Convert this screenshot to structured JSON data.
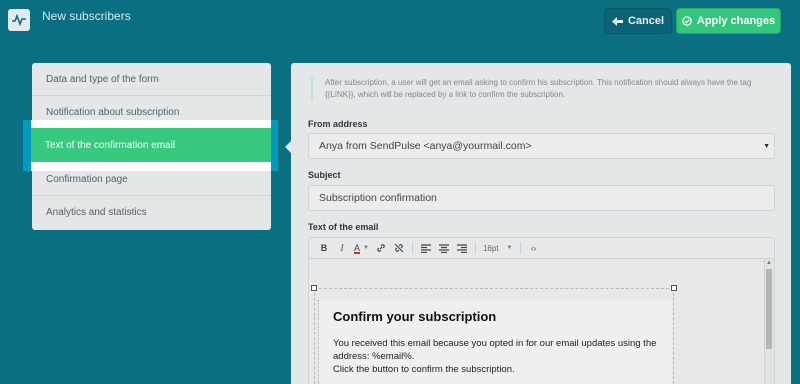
{
  "app": {
    "title": "New subscribers",
    "logo_icon": "pulse-icon"
  },
  "actions": {
    "cancel_label": "Cancel",
    "apply_label": "Apply changes"
  },
  "sidebar": {
    "items": [
      {
        "label": "Data and type of the form"
      },
      {
        "label": "Notification about subscription"
      },
      {
        "label": "Text of the confirmation email"
      },
      {
        "label": "Confirmation page"
      },
      {
        "label": "Analytics and statistics"
      }
    ],
    "active_index": 2
  },
  "panel": {
    "notice": "After subscription, a user will get an email asking to confirm his subscription. This notification should always have the tag {{LINK}}, which will be replaced by a link to confirm the subscription.",
    "from_label": "From address",
    "from_value": "Anya from SendPulse <anya@yourmail.com>",
    "subject_label": "Subject",
    "subject_value": "Subscription confirmation",
    "text_label": "Text of the email",
    "toolbar": {
      "bold": "B",
      "italic": "I",
      "font_color": "A",
      "font_size": "16pt"
    },
    "email": {
      "heading": "Confirm your subscription",
      "body_line1": "You received this email because you opted in for our email updates using the address: %email%.",
      "body_line2": "Click the button to confirm the subscription."
    }
  },
  "colors": {
    "background": "#0a6f80",
    "accent_green": "#37c97f",
    "active_highlight": "#009bbf"
  }
}
